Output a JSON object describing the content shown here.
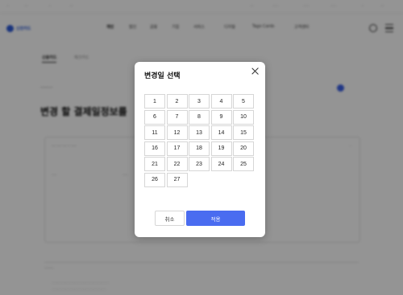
{
  "modal": {
    "title": "변경일 선택",
    "days": [
      "1",
      "2",
      "3",
      "4",
      "5",
      "6",
      "7",
      "8",
      "9",
      "10",
      "11",
      "12",
      "13",
      "14",
      "15",
      "16",
      "17",
      "18",
      "19",
      "20",
      "21",
      "22",
      "23",
      "24",
      "25",
      "26",
      "27"
    ],
    "cancel_label": "취소",
    "apply_label": "적용"
  },
  "background": {
    "logo_text": "신한카드",
    "nav": [
      "개인",
      "법인",
      "금융",
      "기업",
      "서비스",
      "디지털",
      "Tago Cards",
      "고객센터"
    ],
    "tabs": [
      "신용카드",
      "체크카드"
    ],
    "big_title": "변경 할 결제일정보를"
  },
  "colors": {
    "accent": "#4a6cf0",
    "overlay": "rgba(0,0,0,0.42)"
  }
}
